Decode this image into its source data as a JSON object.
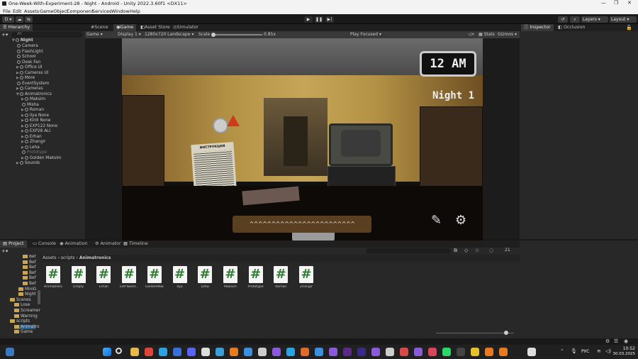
{
  "window": {
    "title": "One-Week-With-Experiment-28 - Night - Android - Unity 2022.3.60f1 <DX11>"
  },
  "menu": [
    "File",
    "Edit",
    "Assets",
    "GameObject",
    "Component",
    "Services",
    "Window",
    "Help"
  ],
  "toolbar": {
    "account": "D",
    "layers": "Layers",
    "layout": "Layout"
  },
  "hierarchy": {
    "tab": "Hierarchy",
    "search_placeholder": "All",
    "scene": "Night",
    "items": [
      "Camera",
      "FlashLight",
      "School",
      "Desk Fan",
      "Office UI",
      "Cameras UI",
      "More",
      "EventSystem",
      "Cameras",
      "Animatronics",
      "Maksim",
      "Misha",
      "Roman",
      "Ilya None",
      "Kirill None",
      "EXP122 None",
      "EXP28 ALI",
      "Erhan",
      "Zhangir",
      "Leha",
      "Prototype",
      "Golden Maksim",
      "Sounds"
    ]
  },
  "scene_tabs": [
    "Scene",
    "Game",
    "Asset Store",
    "Simulator"
  ],
  "game_bar": {
    "mode": "Game",
    "display": "Display 1",
    "resolution": "1280x720 Landscape",
    "scale_label": "Scale",
    "scale_value": "0.85x",
    "play_focused": "Play Focused",
    "stats": "Stats",
    "gizmos": "Gizmos"
  },
  "game_view": {
    "clock": "12 AM",
    "night": "Night 1",
    "subtitle": "^^^^^^^^^^^^^^^^^^^^^^^^",
    "poster_title": "ИНСТРУКЦИЯ"
  },
  "inspector_tabs": [
    "Inspector",
    "Occlusion"
  ],
  "bottom_tabs": [
    "Project",
    "Console",
    "Animation",
    "Animator",
    "Timeline"
  ],
  "breadcrumb": [
    "Assets",
    "scripts",
    "Animatronics"
  ],
  "project_tree": [
    "Bef",
    "Bef",
    "Bef",
    "Bef",
    "Bef",
    "Bef",
    "MiniG",
    "Night",
    "Scenes",
    "Lose",
    "Screamer",
    "Warning",
    "scripts",
    "Animatro",
    "Game"
  ],
  "files": [
    "AnimatronicScr...",
    "Empty",
    "Erhan",
    "EXPTwent...",
    "GoldenMaks...",
    "Ilya",
    "Leha",
    "Maksim",
    "Prototype",
    "Roman",
    "Zhangir"
  ],
  "hidden_count": "21",
  "taskbar": {
    "lang": "РУС",
    "time": "10:52",
    "date": "30.03.2025"
  },
  "colors": {
    "accent": "#3a79bb",
    "script_icon": "#2e7d32"
  }
}
